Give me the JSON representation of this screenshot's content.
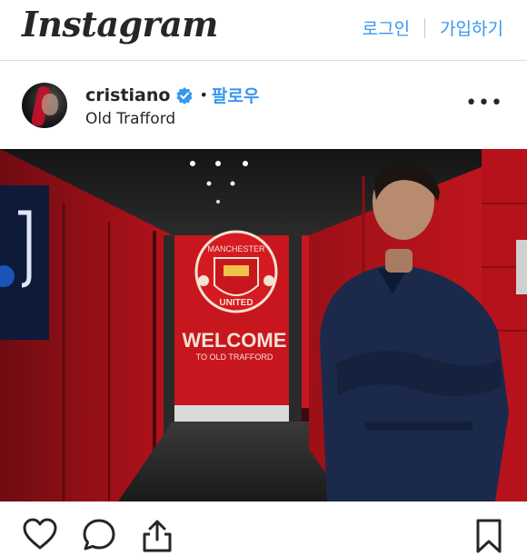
{
  "app": {
    "logo_text": "Instagram"
  },
  "auth": {
    "login_label": "로그인",
    "signup_label": "가입하기"
  },
  "post": {
    "username": "cristiano",
    "separator": "•",
    "follow_label": "팔로우",
    "location": "Old Trafford",
    "image": {
      "crest_top_text": "MANCHESTER",
      "crest_bottom_text": "UNITED",
      "sign_text": "WELCOME",
      "sign_subtext": "TO OLD TRAFFORD"
    }
  },
  "icons": {
    "more": "more-options-icon",
    "verified": "verified-badge-icon",
    "like": "heart-icon",
    "comment": "comment-icon",
    "share": "share-icon",
    "save": "bookmark-icon"
  },
  "colors": {
    "accent": "#3897f0",
    "text": "#262626",
    "tunnel_red": "#b5121b",
    "suit_navy": "#1b2a4a"
  }
}
